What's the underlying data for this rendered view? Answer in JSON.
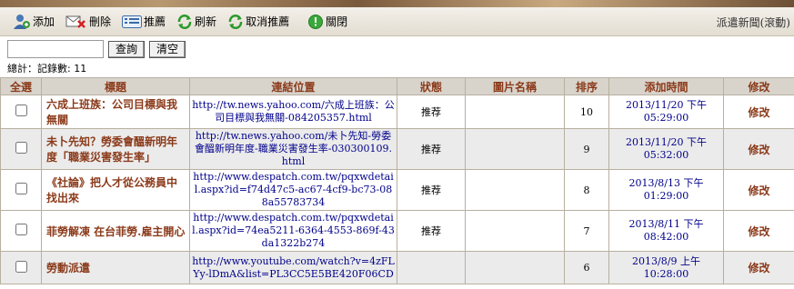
{
  "toolbar": {
    "buttons": [
      {
        "label": "添加",
        "icon": "add-user-icon"
      },
      {
        "label": "刪除",
        "icon": "delete-icon"
      },
      {
        "label": "推薦",
        "icon": "recommend-list-icon"
      },
      {
        "label": "刷新",
        "icon": "refresh-icon"
      },
      {
        "label": "取消推薦",
        "icon": "cancel-recommend-icon"
      },
      {
        "label": "關閉",
        "icon": "close-icon"
      }
    ],
    "title": "派遣新聞(滾動)"
  },
  "search": {
    "value": "",
    "query_label": "查詢",
    "clear_label": "清空"
  },
  "summary": "總計：記錄數: 11",
  "table": {
    "headers": [
      "全選",
      "標題",
      "連結位置",
      "狀態",
      "圖片名稱",
      "排序",
      "添加時間",
      "修改"
    ],
    "rows": [
      {
        "title": "六成上班族：公司目標與我無關",
        "url": "http://tw.news.yahoo.com/六成上班族：公司目標與我無關-084205357.html",
        "status": "推荐",
        "image": "",
        "order": "10",
        "date": "2013/11/20 下午 05:29:00",
        "edit": "修改"
      },
      {
        "title": "未卜先知？勞委會醞新明年度「職業災害發生率」",
        "url": "http://tw.news.yahoo.com/未卜先知-勞委會醞新明年度-職業災害發生率-030300109.html",
        "status": "推荐",
        "image": "",
        "order": "9",
        "date": "2013/11/20 下午 05:32:00",
        "edit": "修改"
      },
      {
        "title": "《社論》把人才從公務員中找出來",
        "url": "http://www.despatch.com.tw/pqxwdetail.aspx?id=f74d47c5-ac67-4cf9-bc73-088a55783734",
        "status": "推荐",
        "image": "",
        "order": "8",
        "date": "2013/8/13 下午 01:29:00",
        "edit": "修改"
      },
      {
        "title": "菲勞解凍 在台菲勞.雇主開心",
        "url": "http://www.despatch.com.tw/pqxwdetail.aspx?id=74ea5211-6364-4553-869f-43da1322b274",
        "status": "推荐",
        "image": "",
        "order": "7",
        "date": "2013/8/11 下午 08:42:00",
        "edit": "修改"
      },
      {
        "title": "勞動派遣",
        "url": "http://www.youtube.com/watch?v=4zFLYy-lDmA&list=PL3CC5E5BE420F06CD",
        "status": "",
        "image": "",
        "order": "6",
        "date": "2013/8/9 上午 10:28:00",
        "edit": "修改"
      }
    ]
  }
}
